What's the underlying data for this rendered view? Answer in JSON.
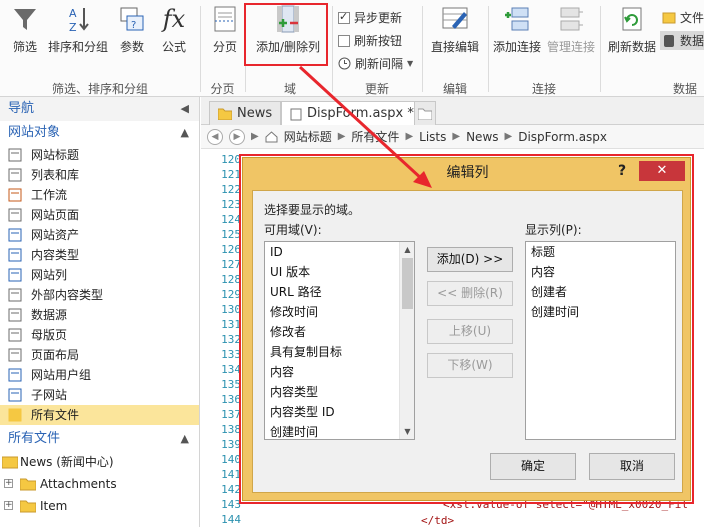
{
  "ribbon": {
    "buttons": {
      "filter": "筛选",
      "sort_group": "排序和分组",
      "params": "参数",
      "formula": "公式",
      "paging": "分页",
      "add_remove_cols": "添加/删除列",
      "inline_edit": "直接编辑",
      "add_connection": "添加连接",
      "manage_connections": "管理连接",
      "refresh_data": "刷新数据",
      "file": "文件",
      "data": "数据"
    },
    "checkboxes": {
      "async_update": "异步更新",
      "refresh_button": "刷新按钮",
      "refresh_interval": "刷新间隔"
    },
    "groups": {
      "filter_sort_group": "筛选、排序和分组",
      "paging": "分页",
      "fields": "域",
      "update": "更新",
      "edit": "编辑",
      "connections": "连接",
      "data": "数据"
    },
    "formula_symbol": "fx"
  },
  "nav": {
    "header": "导航",
    "site_objects_header": "网站对象",
    "items": [
      {
        "label": "网站标题",
        "icon": "home-icon"
      },
      {
        "label": "列表和库",
        "icon": "list-icon"
      },
      {
        "label": "工作流",
        "icon": "workflow-icon"
      },
      {
        "label": "网站页面",
        "icon": "page-icon"
      },
      {
        "label": "网站资产",
        "icon": "assets-icon"
      },
      {
        "label": "内容类型",
        "icon": "content-type-icon"
      },
      {
        "label": "网站列",
        "icon": "column-icon"
      },
      {
        "label": "外部内容类型",
        "icon": "external-content-icon"
      },
      {
        "label": "数据源",
        "icon": "datasource-icon"
      },
      {
        "label": "母版页",
        "icon": "masterpage-icon"
      },
      {
        "label": "页面布局",
        "icon": "layout-icon"
      },
      {
        "label": "网站用户组",
        "icon": "group-icon"
      },
      {
        "label": "子网站",
        "icon": "subsite-icon"
      },
      {
        "label": "所有文件",
        "icon": "folder-icon"
      }
    ],
    "all_files_header": "所有文件",
    "tree": [
      {
        "label": "News (新闻中心)",
        "icon": "site-icon"
      },
      {
        "label": "Attachments",
        "icon": "folder-icon"
      },
      {
        "label": "Item",
        "icon": "folder-icon"
      }
    ]
  },
  "editor": {
    "tabs": [
      "News",
      "DispForm.aspx *"
    ],
    "breadcrumb": [
      "网站标题",
      "所有文件",
      "Lists",
      "News",
      "DispForm.aspx"
    ],
    "line_numbers": [
      "120",
      "121",
      "122",
      "123",
      "124",
      "125",
      "126",
      "127",
      "128",
      "129",
      "130",
      "131",
      "132",
      "133",
      "134",
      "135",
      "136",
      "137",
      "138",
      "139",
      "140",
      "141",
      "142",
      "143",
      "144"
    ],
    "code_tail": "<xsl:value-of select=\"@HTML_x0020_Fil",
    "code_tail2": "</td>"
  },
  "dialog": {
    "title": "编辑列",
    "help": "?",
    "close": "✕",
    "instruction": "选择要显示的域。",
    "available_label": "可用域(V):",
    "displayed_label": "显示列(P):",
    "available_fields": [
      "ID",
      "UI 版本",
      "URL 路径",
      "修改时间",
      "修改者",
      "具有复制目标",
      "内容",
      "内容类型",
      "内容类型 ID",
      "创建时间"
    ],
    "displayed_columns": [
      "标题",
      "内容",
      "创建者",
      "创建时间"
    ],
    "buttons": {
      "add": "添加(D) >>",
      "remove": "<< 删除(R)",
      "move_up": "上移(U)",
      "move_down": "下移(W)",
      "ok": "确定",
      "cancel": "取消"
    }
  },
  "colors": {
    "highlight_red": "#e8262d",
    "dialog_gold": "#f0c565",
    "nav_selected": "#fbe59b",
    "link_blue": "#2a63b4"
  }
}
